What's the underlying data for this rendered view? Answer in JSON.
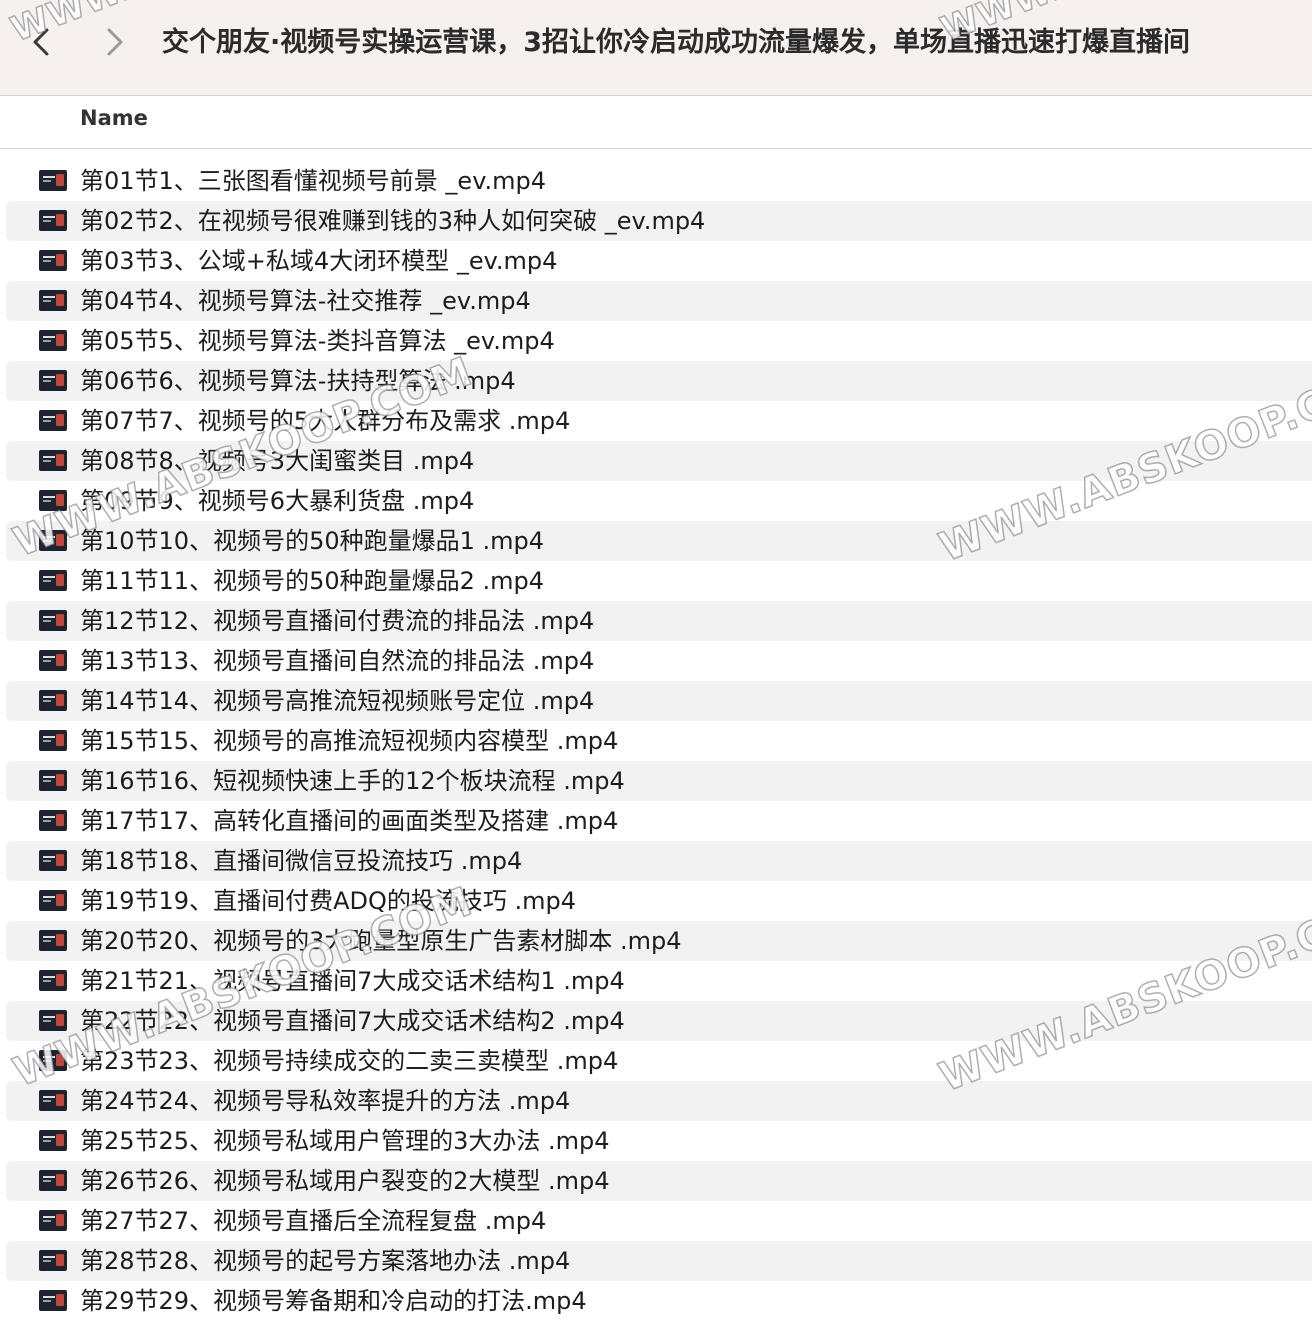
{
  "window": {
    "title": "交个朋友·视频号实操运营课，3招让你冷启动成功流量爆发，单场直播迅速打爆直播间",
    "back_icon": "chevron-left-icon",
    "forward_icon": "chevron-right-icon"
  },
  "list_header": {
    "name_label": "Name"
  },
  "files": [
    "第01节1、三张图看懂视频号前景 _ev.mp4",
    "第02节2、在视频号很难赚到钱的3种人如何突破 _ev.mp4",
    "第03节3、公域+私域4大闭环模型 _ev.mp4",
    "第04节4、视频号算法-社交推荐 _ev.mp4",
    "第05节5、视频号算法-类抖音算法 _ev.mp4",
    "第06节6、视频号算法-扶持型算法 .mp4",
    "第07节7、视频号的5大人群分布及需求 .mp4",
    "第08节8、视频号3大闺蜜类目 .mp4",
    "第09节9、视频号6大暴利货盘 .mp4",
    "第10节10、视频号的50种跑量爆品1 .mp4",
    "第11节11、视频号的50种跑量爆品2 .mp4",
    "第12节12、视频号直播间付费流的排品法 .mp4",
    "第13节13、视频号直播间自然流的排品法 .mp4",
    "第14节14、视频号高推流短视频账号定位 .mp4",
    "第15节15、视频号的高推流短视频内容模型 .mp4",
    "第16节16、短视频快速上手的12个板块流程 .mp4",
    "第17节17、高转化直播间的画面类型及搭建 .mp4",
    "第18节18、直播间微信豆投流技巧 .mp4",
    "第19节19、直播间付费ADQ的投流技巧 .mp4",
    "第20节20、视频号的3大跑量型原生广告素材脚本 .mp4",
    "第21节21、视频号直播间7大成交话术结构1 .mp4",
    "第22节22、视频号直播间7大成交话术结构2 .mp4",
    "第23节23、视频号持续成交的二卖三卖模型 .mp4",
    "第24节24、视频号导私效率提升的方法 .mp4",
    "第25节25、视频号私域用户管理的3大办法 .mp4",
    "第26节26、视频号私域用户裂变的2大模型 .mp4",
    "第27节27、视频号直播后全流程复盘 .mp4",
    "第28节28、视频号的起号方案落地办法 .mp4",
    "第29节29、视频号筹备期和冷启动的打法.mp4"
  ],
  "file_icon": "video-thumbnail-icon",
  "watermark_text": "WWW.ABSKOOP.COM",
  "colors": {
    "titlebar_bg": "#f6f1ee",
    "row_stripe": "#f2f2f2",
    "text": "#1d1d1f"
  }
}
